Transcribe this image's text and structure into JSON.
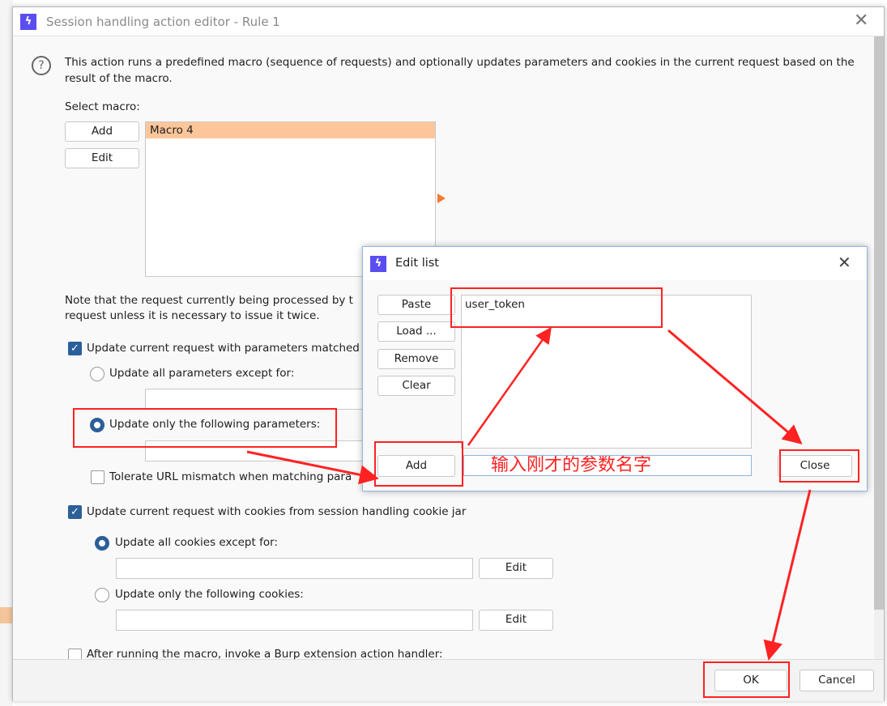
{
  "main_dialog": {
    "title": "Session handling action editor - Rule 1",
    "description": "This action runs a predefined macro (sequence of requests) and optionally updates parameters and cookies in the current request based on the result of the macro.",
    "select_macro_label": "Select macro:",
    "add_label": "Add",
    "edit_label": "Edit",
    "macros": [
      "Macro 4"
    ],
    "note_line1": "Note that the request currently being processed by t",
    "note_line2": "request unless it is necessary to issue it twice.",
    "update_params_label": "Update current request with parameters matched",
    "update_params_checked": true,
    "update_all_params_label": "Update all parameters except for:",
    "update_only_params_label": "Update only the following parameters:",
    "tolerate_url_label": "Tolerate URL mismatch when matching para",
    "tolerate_url_checked": false,
    "update_cookies_label": "Update current request with cookies from session handling cookie jar",
    "update_cookies_checked": true,
    "update_all_cookies_label": "Update all cookies except for:",
    "update_only_cookies_label": "Update only the following cookies:",
    "cookie_edit_label": "Edit",
    "after_macro_label": "After running the macro, invoke a Burp extension action handler:",
    "ok_label": "OK",
    "cancel_label": "Cancel"
  },
  "edit_list": {
    "title": "Edit list",
    "paste_label": "Paste",
    "load_label": "Load ...",
    "remove_label": "Remove",
    "clear_label": "Clear",
    "items": [
      "user_token"
    ],
    "add_label": "Add",
    "input_value": "输入刚才的参数名字",
    "close_label": "Close"
  },
  "colors": {
    "accent": "#2b5f99",
    "selection": "#fdc69a",
    "annotation": "#ff2222",
    "app_icon": "#5b4ef0"
  }
}
